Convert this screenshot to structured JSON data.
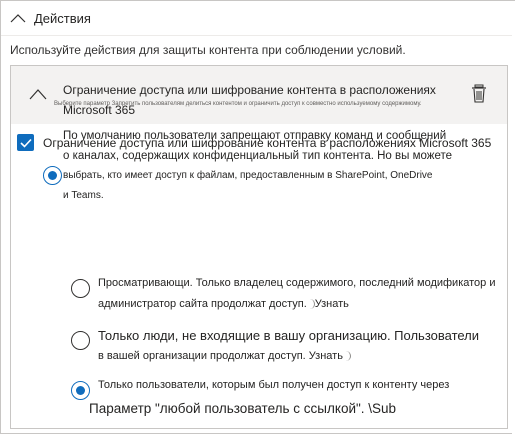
{
  "section": {
    "title": "Действия"
  },
  "intro": "Используйте действия для защиты контента при соблюдении условий.",
  "rule": {
    "title_line1": "Ограничение доступа или шифрование контента в расположениях",
    "title_line2": "Microsoft 365"
  },
  "checkbox": {
    "checked": true,
    "label": "Ограничение доступа или шифрование контента в расположениях Microsoft 365"
  },
  "tiny_option": "Выберите параметр Запретить пользователям делиться контентом и ограничить доступ к совместно используемому содержимому.",
  "description": {
    "line1": "По умолчанию пользователи запрещают отправку команд и сообщений",
    "line2": "о каналах, содержащих конфиденциальный тип контента. Но вы можете",
    "line3": "выбрать, кто имеет доступ к файлам, предоставленным в SharePoint, OneDrive",
    "line4": "и Teams."
  },
  "options": [
    {
      "selected": false,
      "line1": "Просматривающи. Только владелец содержимого, последний модификатор и",
      "line2": "администратор сайта продолжат доступ.",
      "learn": "Узнать"
    },
    {
      "selected": false,
      "line1": "Только люди, не входящие в вашу организацию. Пользователи",
      "line2": "в вашей организации продолжат доступ.",
      "learn": "Узнать"
    },
    {
      "selected": true,
      "line1": "Только пользователи, которым был получен доступ к контенту через",
      "line2": "Параметр \"любой пользователь с ссылкой\". \\Sub"
    }
  ],
  "colors": {
    "accent": "#0f6cbd",
    "header_bg": "#f3f2f1",
    "border": "#c8c6c4"
  },
  "icons": {
    "collapse": "chevron-up-icon",
    "delete": "trash-icon",
    "check": "checkmark-icon"
  }
}
